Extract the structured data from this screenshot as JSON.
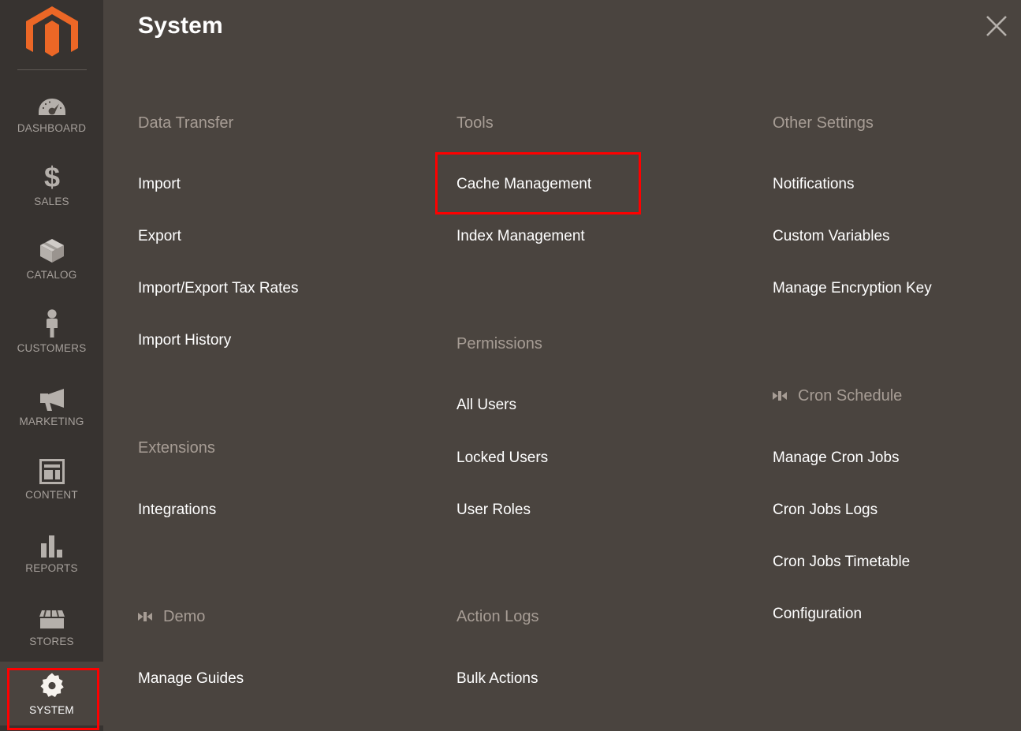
{
  "sidebar": {
    "logo": {
      "name": "magento-logo",
      "color": "#ec6726"
    },
    "items": [
      {
        "id": "dashboard",
        "label": "DASHBOARD",
        "icon": "dashboard-gauge-icon",
        "active": false
      },
      {
        "id": "sales",
        "label": "SALES",
        "icon": "dollar-sign-icon",
        "active": false
      },
      {
        "id": "catalog",
        "label": "CATALOG",
        "icon": "box-icon",
        "active": false
      },
      {
        "id": "customers",
        "label": "CUSTOMERS",
        "icon": "person-icon",
        "active": false
      },
      {
        "id": "marketing",
        "label": "MARKETING",
        "icon": "megaphone-icon",
        "active": false
      },
      {
        "id": "content",
        "label": "CONTENT",
        "icon": "layout-icon",
        "active": false
      },
      {
        "id": "reports",
        "label": "REPORTS",
        "icon": "bar-chart-icon",
        "active": false
      },
      {
        "id": "stores",
        "label": "STORES",
        "icon": "storefront-icon",
        "active": false
      },
      {
        "id": "system",
        "label": "SYSTEM",
        "icon": "gear-icon",
        "active": true
      }
    ]
  },
  "header": {
    "title": "System",
    "close_icon": "close-icon"
  },
  "columns": [
    {
      "id": "column-1",
      "groups": [
        {
          "id": "data-transfer",
          "title": "Data Transfer",
          "icon": null,
          "items": [
            {
              "label": "Import"
            },
            {
              "label": "Export"
            },
            {
              "label": "Import/Export Tax Rates"
            },
            {
              "label": "Import History"
            }
          ]
        },
        {
          "id": "extensions",
          "title": "Extensions",
          "icon": null,
          "items": [
            {
              "label": "Integrations"
            }
          ]
        },
        {
          "id": "demo",
          "title": "Demo",
          "icon": "commerce-bowtie-icon",
          "items": [
            {
              "label": "Manage Guides"
            }
          ]
        }
      ]
    },
    {
      "id": "column-2",
      "groups": [
        {
          "id": "tools",
          "title": "Tools",
          "icon": null,
          "items": [
            {
              "label": "Cache Management",
              "highlighted": true
            },
            {
              "label": "Index Management"
            }
          ]
        },
        {
          "id": "permissions",
          "title": "Permissions",
          "icon": null,
          "items": [
            {
              "label": "All Users"
            },
            {
              "label": "Locked Users"
            },
            {
              "label": "User Roles"
            }
          ]
        },
        {
          "id": "action-logs",
          "title": "Action Logs",
          "icon": null,
          "items": [
            {
              "label": "Bulk Actions"
            }
          ]
        }
      ]
    },
    {
      "id": "column-3",
      "groups": [
        {
          "id": "other-settings",
          "title": "Other Settings",
          "icon": null,
          "items": [
            {
              "label": "Notifications"
            },
            {
              "label": "Custom Variables"
            },
            {
              "label": "Manage Encryption Key"
            }
          ]
        },
        {
          "id": "cron-schedule",
          "title": "Cron Schedule",
          "icon": "commerce-bowtie-icon",
          "items": [
            {
              "label": "Manage Cron Jobs"
            },
            {
              "label": "Cron Jobs Logs"
            },
            {
              "label": "Cron Jobs Timetable"
            },
            {
              "label": "Configuration"
            }
          ]
        }
      ]
    }
  ],
  "annotations": [
    {
      "id": "annot-cache-management",
      "target": "Cache Management",
      "color": "#fe0000"
    },
    {
      "id": "annot-system-nav",
      "target": "SYSTEM",
      "color": "#fe0000"
    }
  ],
  "colors": {
    "panel_bg": "#4a443f",
    "sidebar_bg": "#373330",
    "group_title": "#a79d95",
    "item_text": "#ffffff",
    "nav_label": "#a6a09b",
    "accent_orange": "#ec6726",
    "annotation_red": "#fe0000"
  }
}
